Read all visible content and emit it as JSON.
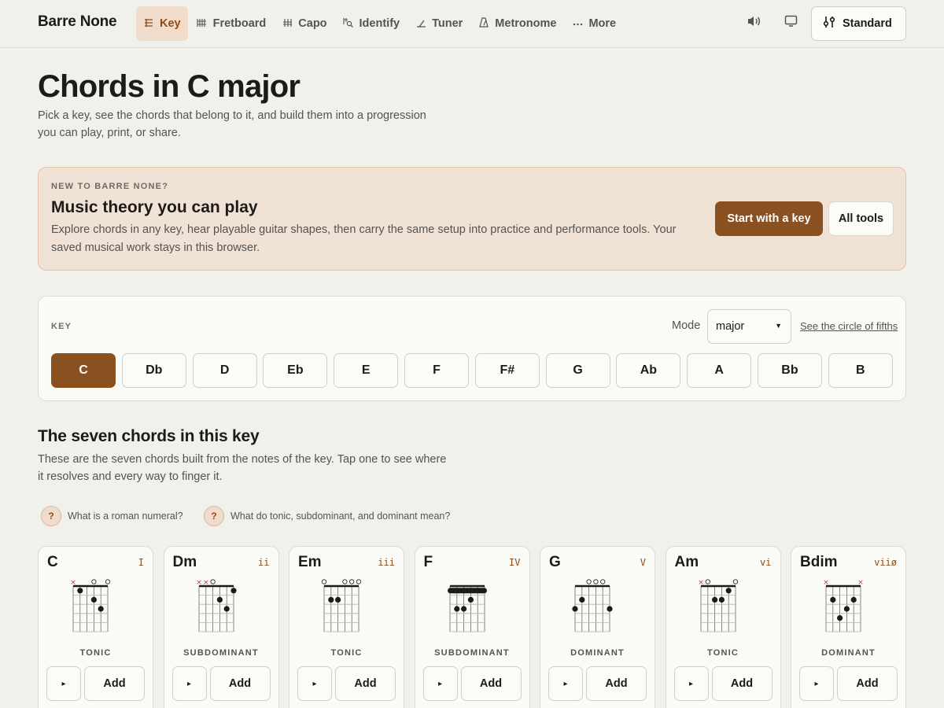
{
  "app": {
    "brand": "Barre None"
  },
  "nav": {
    "items": [
      {
        "label": "Key",
        "icon": "key-icon",
        "active": true
      },
      {
        "label": "Fretboard",
        "icon": "fretboard-icon",
        "active": false
      },
      {
        "label": "Capo",
        "icon": "capo-icon",
        "active": false
      },
      {
        "label": "Identify",
        "icon": "identify-icon",
        "active": false
      },
      {
        "label": "Tuner",
        "icon": "tuner-icon",
        "active": false
      },
      {
        "label": "Metronome",
        "icon": "metronome-icon",
        "active": false
      },
      {
        "label": "More",
        "icon": "more-icon",
        "active": false
      }
    ],
    "tuning_label": "Standard"
  },
  "header": {
    "title": "Chords in C major",
    "subtitle": "Pick a key, see the chords that belong to it, and build them into a progression you can play, print, or share."
  },
  "intro": {
    "eyebrow": "NEW TO BARRE NONE?",
    "title": "Music theory you can play",
    "body": "Explore chords in any key, hear playable guitar shapes, then carry the same setup into practice and performance tools. Your saved musical work stays in this browser.",
    "primary_label": "Start with a key",
    "secondary_label": "All tools"
  },
  "key_picker": {
    "label": "KEY",
    "mode_label": "Mode",
    "mode_value": "major",
    "circle_link": "See the circle of fifths",
    "keys": [
      "C",
      "Db",
      "D",
      "Eb",
      "E",
      "F",
      "F#",
      "G",
      "Ab",
      "A",
      "Bb",
      "B"
    ],
    "selected": "C"
  },
  "chords_section": {
    "title": "The seven chords in this key",
    "subtitle": "These are the seven chords built from the notes of the key. Tap one to see where it resolves and every way to finger it.",
    "help_numeral": "What is a roman numeral?",
    "help_function": "What do tonic, subdominant, and dominant mean?",
    "play_symbol": "▸",
    "add_label": "Add",
    "chords": [
      {
        "name": "C",
        "numeral": "I",
        "function": "TONIC"
      },
      {
        "name": "Dm",
        "numeral": "ii",
        "function": "SUBDOMINANT"
      },
      {
        "name": "Em",
        "numeral": "iii",
        "function": "TONIC"
      },
      {
        "name": "F",
        "numeral": "IV",
        "function": "SUBDOMINANT"
      },
      {
        "name": "G",
        "numeral": "V",
        "function": "DOMINANT"
      },
      {
        "name": "Am",
        "numeral": "vi",
        "function": "TONIC"
      },
      {
        "name": "Bdim",
        "numeral": "viiø",
        "function": "DOMINANT"
      }
    ]
  },
  "colors": {
    "accent": "#8a5020",
    "background": "#f1f1ec",
    "intro_bg": "#f1e2d6",
    "muted_x": "#c0392b"
  }
}
